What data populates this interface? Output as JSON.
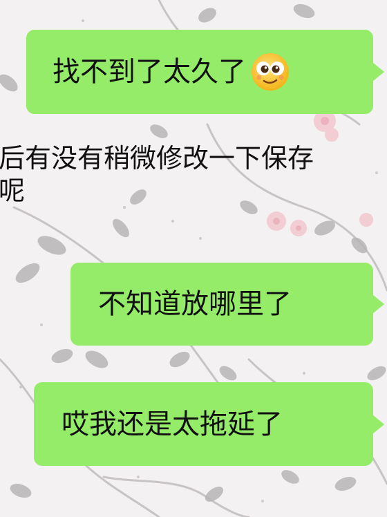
{
  "chat": {
    "messages": [
      {
        "direction": "outgoing",
        "text": "找不到了太久了",
        "emoji": "dizzy-face-emoji"
      },
      {
        "direction": "incoming",
        "line1": "后有没有稍微修改一下保存",
        "line2": "呢"
      },
      {
        "direction": "outgoing",
        "text": "不知道放哪里了"
      },
      {
        "direction": "outgoing",
        "text": "哎我还是太拖延了"
      }
    ]
  },
  "colors": {
    "outgoing_bubble": "#95ec69",
    "text": "#111111",
    "wallpaper": "#f3f1f2"
  }
}
